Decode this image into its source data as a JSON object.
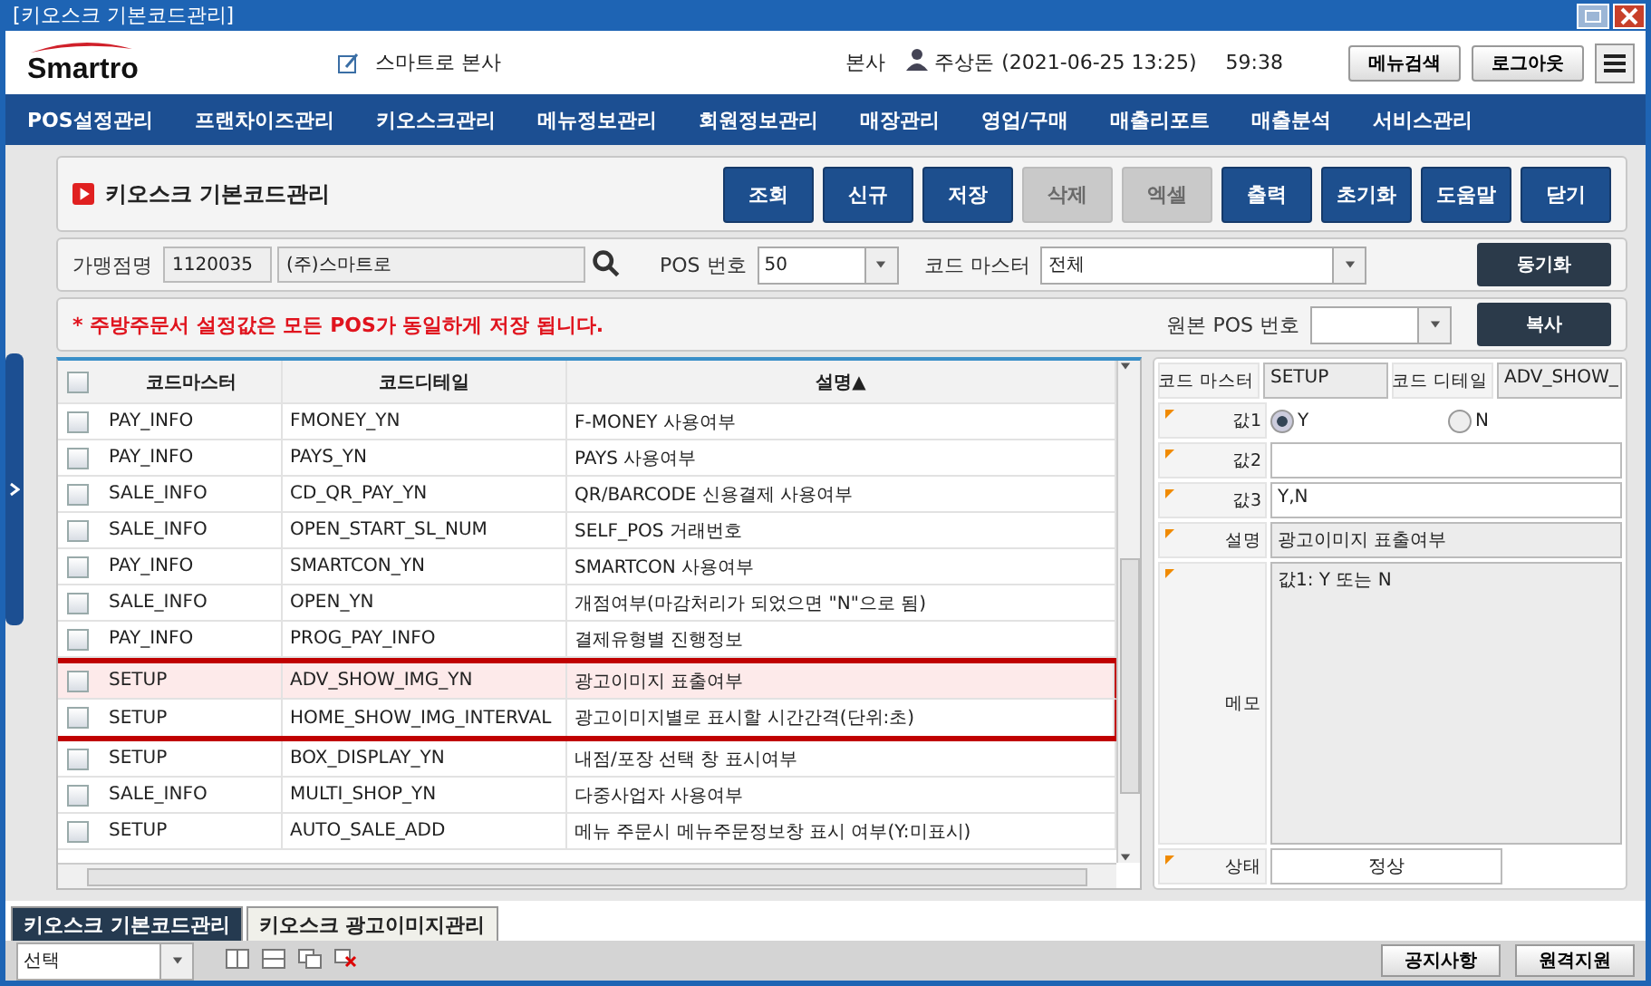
{
  "window": {
    "title": "[키오스크 기본코드관리]"
  },
  "header": {
    "logo": "Smartro",
    "company": "스마트로 본사",
    "branch": "본사",
    "user": "주상돈",
    "datetime": "(2021-06-25 13:25)",
    "timer": "59:38",
    "buttons": [
      "메뉴검색",
      "로그아웃"
    ]
  },
  "nav": [
    "POS설정관리",
    "프랜차이즈관리",
    "키오스크관리",
    "메뉴정보관리",
    "회원정보관리",
    "매장관리",
    "영업/구매",
    "매출리포트",
    "매출분석",
    "서비스관리"
  ],
  "page_title": "키오스크 기본코드관리",
  "toolbar": [
    {
      "label": "조회",
      "disabled": false
    },
    {
      "label": "신규",
      "disabled": false
    },
    {
      "label": "저장",
      "disabled": false
    },
    {
      "label": "삭제",
      "disabled": true
    },
    {
      "label": "엑셀",
      "disabled": true
    },
    {
      "label": "출력",
      "disabled": false
    },
    {
      "label": "초기화",
      "disabled": false
    },
    {
      "label": "도움말",
      "disabled": false
    },
    {
      "label": "닫기",
      "disabled": false
    }
  ],
  "filters": {
    "store_label": "가맹점명",
    "store_code": "1120035",
    "store_name": "(주)스마트로",
    "pos_label": "POS 번호",
    "pos_value": "50",
    "master_label": "코드 마스터",
    "master_value": "전체",
    "sync_button": "동기화"
  },
  "notice": "* 주방주문서 설정값은 모든 POS가 동일하게 저장 됩니다.",
  "source_pos_label": "원본 POS 번호",
  "copy_button": "복사",
  "table": {
    "select_all_checked": false,
    "columns": [
      "코드마스터",
      "코드디테일",
      "설명▲"
    ],
    "rows": [
      {
        "cells": [
          "PAY_INFO",
          "FMONEY_YN",
          "F-MONEY 사용여부"
        ],
        "checked": false,
        "selected": false,
        "highlighted": false
      },
      {
        "cells": [
          "PAY_INFO",
          "PAYS_YN",
          "PAYS 사용여부"
        ],
        "checked": false,
        "selected": false,
        "highlighted": false
      },
      {
        "cells": [
          "SALE_INFO",
          "CD_QR_PAY_YN",
          "QR/BARCODE 신용결제 사용여부"
        ],
        "checked": false,
        "selected": false,
        "highlighted": false
      },
      {
        "cells": [
          "SALE_INFO",
          "OPEN_START_SL_NUM",
          "SELF_POS 거래번호"
        ],
        "checked": false,
        "selected": false,
        "highlighted": false
      },
      {
        "cells": [
          "PAY_INFO",
          "SMARTCON_YN",
          "SMARTCON 사용여부"
        ],
        "checked": false,
        "selected": false,
        "highlighted": false
      },
      {
        "cells": [
          "SALE_INFO",
          "OPEN_YN",
          "개점여부(마감처리가 되었으면 \"N\"으로 됨)"
        ],
        "checked": false,
        "selected": false,
        "highlighted": false
      },
      {
        "cells": [
          "PAY_INFO",
          "PROG_PAY_INFO",
          "결제유형별 진행정보"
        ],
        "checked": false,
        "selected": false,
        "highlighted": false
      },
      {
        "cells": [
          "SETUP",
          "ADV_SHOW_IMG_YN",
          "광고이미지 표출여부"
        ],
        "checked": false,
        "selected": true,
        "highlighted": true
      },
      {
        "cells": [
          "SETUP",
          "HOME_SHOW_IMG_INTERVAL",
          "광고이미지별로 표시할 시간간격(단위:초)"
        ],
        "checked": false,
        "selected": false,
        "highlighted": true
      },
      {
        "cells": [
          "SETUP",
          "BOX_DISPLAY_YN",
          "내점/포장 선택 창 표시여부"
        ],
        "checked": false,
        "selected": false,
        "highlighted": false
      },
      {
        "cells": [
          "SALE_INFO",
          "MULTI_SHOP_YN",
          "다중사업자 사용여부"
        ],
        "checked": false,
        "selected": false,
        "highlighted": false
      },
      {
        "cells": [
          "SETUP",
          "AUTO_SALE_ADD",
          "메뉴 주문시 메뉴주문정보창 표시 여부(Y:미표시)"
        ],
        "checked": false,
        "selected": false,
        "highlighted": false
      }
    ]
  },
  "detail": {
    "master_label": "코드 마스터",
    "master_value": "SETUP",
    "detail_label": "코드 디테일",
    "detail_value": "ADV_SHOW_",
    "value1_label": "값1",
    "value1_options": [
      {
        "label": "Y",
        "selected": true
      },
      {
        "label": "N",
        "selected": false
      }
    ],
    "value2_label": "값2",
    "value3_label": "값3",
    "value3": "Y,N",
    "desc_label": "설명",
    "desc": "광고이미지 표출여부",
    "memo_label": "메모",
    "memo": "값1: Y 또는 N",
    "status_label": "상태",
    "status": "정상"
  },
  "bottom_tabs": [
    {
      "label": "키오스크 기본코드관리",
      "selected": true
    },
    {
      "label": "키오스크 광고이미지관리",
      "selected": false
    }
  ],
  "status_bar": {
    "select": "선택",
    "buttons": [
      "공지사항",
      "원격지원"
    ]
  }
}
